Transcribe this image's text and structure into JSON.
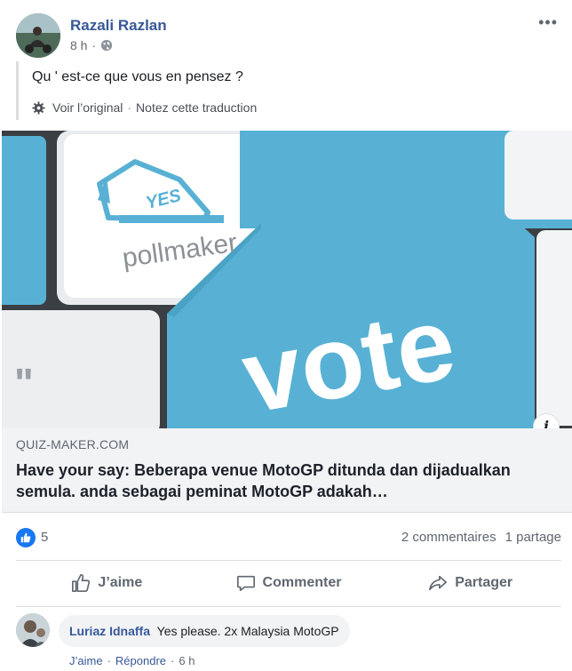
{
  "post": {
    "author": "Razali Razlan",
    "time": "8 h",
    "text": "Qu ' est-ce que vous en pensez ?",
    "more_label": "•••"
  },
  "translation": {
    "see_original": "Voir l’original",
    "rate_translation": "Notez cette traduction",
    "separator": "·"
  },
  "link": {
    "image_keycap_brand": "pollmaker",
    "image_keycap_stamp": "YES",
    "image_main_word": "vote",
    "image_quote_key": "\"",
    "info_label": "i",
    "domain": "QUIZ-MAKER.COM",
    "title": "Have your say: Beberapa venue MotoGP ditunda dan dijadualkan semula. anda sebagai peminat MotoGP adakah…"
  },
  "reactions": {
    "count": "5",
    "comments": "2 commentaires",
    "shares": "1 partage"
  },
  "actions": {
    "like": "J’aime",
    "comment": "Commenter",
    "share": "Partager"
  },
  "comment": {
    "author": "Luriaz Idnaffa",
    "text": "Yes please. 2x Malaysia MotoGP",
    "like": "J’aime",
    "reply": "Répondre",
    "time": "6 h",
    "separator": "·"
  },
  "icons": {
    "globe": "globe-icon",
    "gear": "gear-icon",
    "like_reaction": "like-reaction-icon",
    "thumbs_up": "thumbs-up-icon",
    "comment": "comment-icon",
    "share": "share-icon",
    "info": "info-icon",
    "more": "more-icon"
  },
  "colors": {
    "link_blue": "#385898",
    "like_blue": "#1877f2",
    "keyboard_blue": "#58b1d4",
    "preview_bg": "#f2f3f5"
  }
}
